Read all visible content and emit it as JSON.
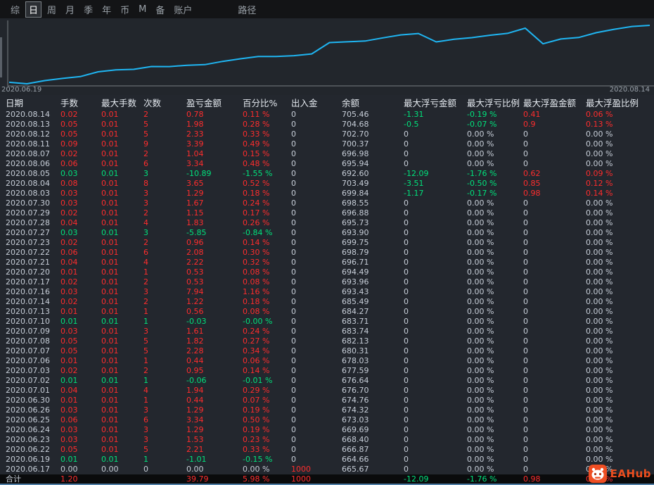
{
  "menu": {
    "items": [
      {
        "label": "综",
        "selected": false
      },
      {
        "label": "日",
        "selected": true
      },
      {
        "label": "周",
        "selected": false
      },
      {
        "label": "月",
        "selected": false
      },
      {
        "label": "季",
        "selected": false
      },
      {
        "label": "年",
        "selected": false
      },
      {
        "label": "币",
        "selected": false
      },
      {
        "label": "M",
        "selected": false
      },
      {
        "label": "备",
        "selected": false
      },
      {
        "label": "账户",
        "selected": false
      },
      {
        "label": "路径",
        "selected": false,
        "gap_before": true
      }
    ]
  },
  "chart": {
    "left_label": "2020.06.19",
    "right_label": "2020.08.14"
  },
  "chart_data": {
    "type": "line",
    "title": "",
    "xlabel": "",
    "ylabel": "",
    "legend": [],
    "grid": false,
    "line_color": "#1fb5f2",
    "x": [
      "2020.06.17",
      "2020.06.19",
      "2020.06.22",
      "2020.06.23",
      "2020.06.24",
      "2020.06.25",
      "2020.06.26",
      "2020.06.30",
      "2020.07.01",
      "2020.07.02",
      "2020.07.03",
      "2020.07.06",
      "2020.07.07",
      "2020.07.08",
      "2020.07.09",
      "2020.07.10",
      "2020.07.13",
      "2020.07.14",
      "2020.07.16",
      "2020.07.17",
      "2020.07.20",
      "2020.07.21",
      "2020.07.22",
      "2020.07.23",
      "2020.07.27",
      "2020.07.28",
      "2020.07.29",
      "2020.07.30",
      "2020.08.03",
      "2020.08.04",
      "2020.08.05",
      "2020.08.06",
      "2020.08.07",
      "2020.08.11",
      "2020.08.12",
      "2020.08.13",
      "2020.08.14"
    ],
    "values": [
      665.67,
      664.66,
      666.87,
      668.4,
      669.69,
      673.03,
      674.32,
      674.76,
      676.7,
      676.64,
      677.59,
      678.03,
      680.31,
      682.13,
      683.74,
      683.71,
      684.27,
      685.49,
      693.43,
      693.96,
      694.49,
      696.71,
      698.79,
      699.75,
      693.9,
      695.73,
      696.88,
      698.55,
      699.84,
      703.49,
      692.6,
      695.94,
      696.98,
      700.37,
      702.7,
      704.68,
      705.46
    ],
    "ylim": [
      664.66,
      705.46
    ],
    "x_axis_labels": [
      "2020.06.19",
      "2020.08.14"
    ]
  },
  "table": {
    "columns": [
      "日期",
      "手数",
      "最大手数",
      "次数",
      "盈亏金额",
      "百分比%",
      "出入金",
      "余额",
      "最大浮亏金额",
      "最大浮亏比例",
      "最大浮盈金额",
      "最大浮盈比例"
    ],
    "rows": [
      {
        "trend": "up",
        "cells": [
          "2020.08.14",
          "0.02",
          "0.01",
          "2",
          "0.78",
          "0.11 %",
          "0",
          "705.46",
          "-1.31",
          "-0.19 %",
          "0.41",
          "0.06 %"
        ]
      },
      {
        "trend": "up",
        "cells": [
          "2020.08.13",
          "0.05",
          "0.01",
          "5",
          "1.98",
          "0.28 %",
          "0",
          "704.68",
          "-0.5",
          "-0.07 %",
          "0.9",
          "0.13 %"
        ]
      },
      {
        "trend": "up",
        "cells": [
          "2020.08.12",
          "0.05",
          "0.01",
          "5",
          "2.33",
          "0.33 %",
          "0",
          "702.70",
          "0",
          "0.00 %",
          "0",
          "0.00 %"
        ]
      },
      {
        "trend": "up",
        "cells": [
          "2020.08.11",
          "0.09",
          "0.01",
          "9",
          "3.39",
          "0.49 %",
          "0",
          "700.37",
          "0",
          "0.00 %",
          "0",
          "0.00 %"
        ]
      },
      {
        "trend": "up",
        "cells": [
          "2020.08.07",
          "0.02",
          "0.01",
          "2",
          "1.04",
          "0.15 %",
          "0",
          "696.98",
          "0",
          "0.00 %",
          "0",
          "0.00 %"
        ]
      },
      {
        "trend": "up",
        "cells": [
          "2020.08.06",
          "0.06",
          "0.01",
          "6",
          "3.34",
          "0.48 %",
          "0",
          "695.94",
          "0",
          "0.00 %",
          "0",
          "0.00 %"
        ]
      },
      {
        "trend": "down",
        "cells": [
          "2020.08.05",
          "0.03",
          "0.01",
          "3",
          "-10.89",
          "-1.55 %",
          "0",
          "692.60",
          "-12.09",
          "-1.76 %",
          "0.62",
          "0.09 %"
        ]
      },
      {
        "trend": "up",
        "cells": [
          "2020.08.04",
          "0.08",
          "0.01",
          "8",
          "3.65",
          "0.52 %",
          "0",
          "703.49",
          "-3.51",
          "-0.50 %",
          "0.85",
          "0.12 %"
        ]
      },
      {
        "trend": "up",
        "cells": [
          "2020.08.03",
          "0.03",
          "0.01",
          "3",
          "1.29",
          "0.18 %",
          "0",
          "699.84",
          "-1.17",
          "-0.17 %",
          "0.98",
          "0.14 %"
        ]
      },
      {
        "trend": "up",
        "cells": [
          "2020.07.30",
          "0.03",
          "0.01",
          "3",
          "1.67",
          "0.24 %",
          "0",
          "698.55",
          "0",
          "0.00 %",
          "0",
          "0.00 %"
        ]
      },
      {
        "trend": "up",
        "cells": [
          "2020.07.29",
          "0.02",
          "0.01",
          "2",
          "1.15",
          "0.17 %",
          "0",
          "696.88",
          "0",
          "0.00 %",
          "0",
          "0.00 %"
        ]
      },
      {
        "trend": "up",
        "cells": [
          "2020.07.28",
          "0.04",
          "0.01",
          "4",
          "1.83",
          "0.26 %",
          "0",
          "695.73",
          "0",
          "0.00 %",
          "0",
          "0.00 %"
        ]
      },
      {
        "trend": "down",
        "cells": [
          "2020.07.27",
          "0.03",
          "0.01",
          "3",
          "-5.85",
          "-0.84 %",
          "0",
          "693.90",
          "0",
          "0.00 %",
          "0",
          "0.00 %"
        ]
      },
      {
        "trend": "up",
        "cells": [
          "2020.07.23",
          "0.02",
          "0.01",
          "2",
          "0.96",
          "0.14 %",
          "0",
          "699.75",
          "0",
          "0.00 %",
          "0",
          "0.00 %"
        ]
      },
      {
        "trend": "up",
        "cells": [
          "2020.07.22",
          "0.06",
          "0.01",
          "6",
          "2.08",
          "0.30 %",
          "0",
          "698.79",
          "0",
          "0.00 %",
          "0",
          "0.00 %"
        ]
      },
      {
        "trend": "up",
        "cells": [
          "2020.07.21",
          "0.04",
          "0.01",
          "4",
          "2.22",
          "0.32 %",
          "0",
          "696.71",
          "0",
          "0.00 %",
          "0",
          "0.00 %"
        ]
      },
      {
        "trend": "up",
        "cells": [
          "2020.07.20",
          "0.01",
          "0.01",
          "1",
          "0.53",
          "0.08 %",
          "0",
          "694.49",
          "0",
          "0.00 %",
          "0",
          "0.00 %"
        ]
      },
      {
        "trend": "up",
        "cells": [
          "2020.07.17",
          "0.02",
          "0.01",
          "2",
          "0.53",
          "0.08 %",
          "0",
          "693.96",
          "0",
          "0.00 %",
          "0",
          "0.00 %"
        ]
      },
      {
        "trend": "up",
        "cells": [
          "2020.07.16",
          "0.03",
          "0.01",
          "3",
          "7.94",
          "1.16 %",
          "0",
          "693.43",
          "0",
          "0.00 %",
          "0",
          "0.00 %"
        ]
      },
      {
        "trend": "up",
        "cells": [
          "2020.07.14",
          "0.02",
          "0.01",
          "2",
          "1.22",
          "0.18 %",
          "0",
          "685.49",
          "0",
          "0.00 %",
          "0",
          "0.00 %"
        ]
      },
      {
        "trend": "up",
        "cells": [
          "2020.07.13",
          "0.01",
          "0.01",
          "1",
          "0.56",
          "0.08 %",
          "0",
          "684.27",
          "0",
          "0.00 %",
          "0",
          "0.00 %"
        ]
      },
      {
        "trend": "down",
        "cells": [
          "2020.07.10",
          "0.01",
          "0.01",
          "1",
          "-0.03",
          "-0.00 %",
          "0",
          "683.71",
          "0",
          "0.00 %",
          "0",
          "0.00 %"
        ]
      },
      {
        "trend": "up",
        "cells": [
          "2020.07.09",
          "0.03",
          "0.01",
          "3",
          "1.61",
          "0.24 %",
          "0",
          "683.74",
          "0",
          "0.00 %",
          "0",
          "0.00 %"
        ]
      },
      {
        "trend": "up",
        "cells": [
          "2020.07.08",
          "0.05",
          "0.01",
          "5",
          "1.82",
          "0.27 %",
          "0",
          "682.13",
          "0",
          "0.00 %",
          "0",
          "0.00 %"
        ]
      },
      {
        "trend": "up",
        "cells": [
          "2020.07.07",
          "0.05",
          "0.01",
          "5",
          "2.28",
          "0.34 %",
          "0",
          "680.31",
          "0",
          "0.00 %",
          "0",
          "0.00 %"
        ]
      },
      {
        "trend": "up",
        "cells": [
          "2020.07.06",
          "0.01",
          "0.01",
          "1",
          "0.44",
          "0.06 %",
          "0",
          "678.03",
          "0",
          "0.00 %",
          "0",
          "0.00 %"
        ]
      },
      {
        "trend": "up",
        "cells": [
          "2020.07.03",
          "0.02",
          "0.01",
          "2",
          "0.95",
          "0.14 %",
          "0",
          "677.59",
          "0",
          "0.00 %",
          "0",
          "0.00 %"
        ]
      },
      {
        "trend": "down",
        "cells": [
          "2020.07.02",
          "0.01",
          "0.01",
          "1",
          "-0.06",
          "-0.01 %",
          "0",
          "676.64",
          "0",
          "0.00 %",
          "0",
          "0.00 %"
        ]
      },
      {
        "trend": "up",
        "cells": [
          "2020.07.01",
          "0.04",
          "0.01",
          "4",
          "1.94",
          "0.29 %",
          "0",
          "676.70",
          "0",
          "0.00 %",
          "0",
          "0.00 %"
        ]
      },
      {
        "trend": "up",
        "cells": [
          "2020.06.30",
          "0.01",
          "0.01",
          "1",
          "0.44",
          "0.07 %",
          "0",
          "674.76",
          "0",
          "0.00 %",
          "0",
          "0.00 %"
        ]
      },
      {
        "trend": "up",
        "cells": [
          "2020.06.26",
          "0.03",
          "0.01",
          "3",
          "1.29",
          "0.19 %",
          "0",
          "674.32",
          "0",
          "0.00 %",
          "0",
          "0.00 %"
        ]
      },
      {
        "trend": "up",
        "cells": [
          "2020.06.25",
          "0.06",
          "0.01",
          "6",
          "3.34",
          "0.50 %",
          "0",
          "673.03",
          "0",
          "0.00 %",
          "0",
          "0.00 %"
        ]
      },
      {
        "trend": "up",
        "cells": [
          "2020.06.24",
          "0.03",
          "0.01",
          "3",
          "1.29",
          "0.19 %",
          "0",
          "669.69",
          "0",
          "0.00 %",
          "0",
          "0.00 %"
        ]
      },
      {
        "trend": "up",
        "cells": [
          "2020.06.23",
          "0.03",
          "0.01",
          "3",
          "1.53",
          "0.23 %",
          "0",
          "668.40",
          "0",
          "0.00 %",
          "0",
          "0.00 %"
        ]
      },
      {
        "trend": "up",
        "cells": [
          "2020.06.22",
          "0.05",
          "0.01",
          "5",
          "2.21",
          "0.33 %",
          "0",
          "666.87",
          "0",
          "0.00 %",
          "0",
          "0.00 %"
        ]
      },
      {
        "trend": "down",
        "cells": [
          "2020.06.19",
          "0.01",
          "0.01",
          "1",
          "-1.01",
          "-0.15 %",
          "0",
          "664.66",
          "0",
          "0.00 %",
          "0",
          "0.00 %"
        ]
      },
      {
        "trend": "flat",
        "cells": [
          "2020.06.17",
          "0.00",
          "0.00",
          "0",
          "0.00",
          "0.00 %",
          "1000",
          "665.67",
          "0",
          "0.00 %",
          "0",
          "0.00 %"
        ]
      }
    ],
    "total": {
      "trend": "up",
      "cells": [
        "合计",
        "1.20",
        "",
        "",
        "39.79",
        "5.98 %",
        "1000",
        "",
        "-12.09",
        "-1.76 %",
        "0.98",
        "0.14 %"
      ]
    }
  },
  "watermark": {
    "text": "EAHub"
  },
  "colors": {
    "red": "#ff2d2d",
    "green": "#00e27c",
    "accent": "#1fb5f2"
  }
}
